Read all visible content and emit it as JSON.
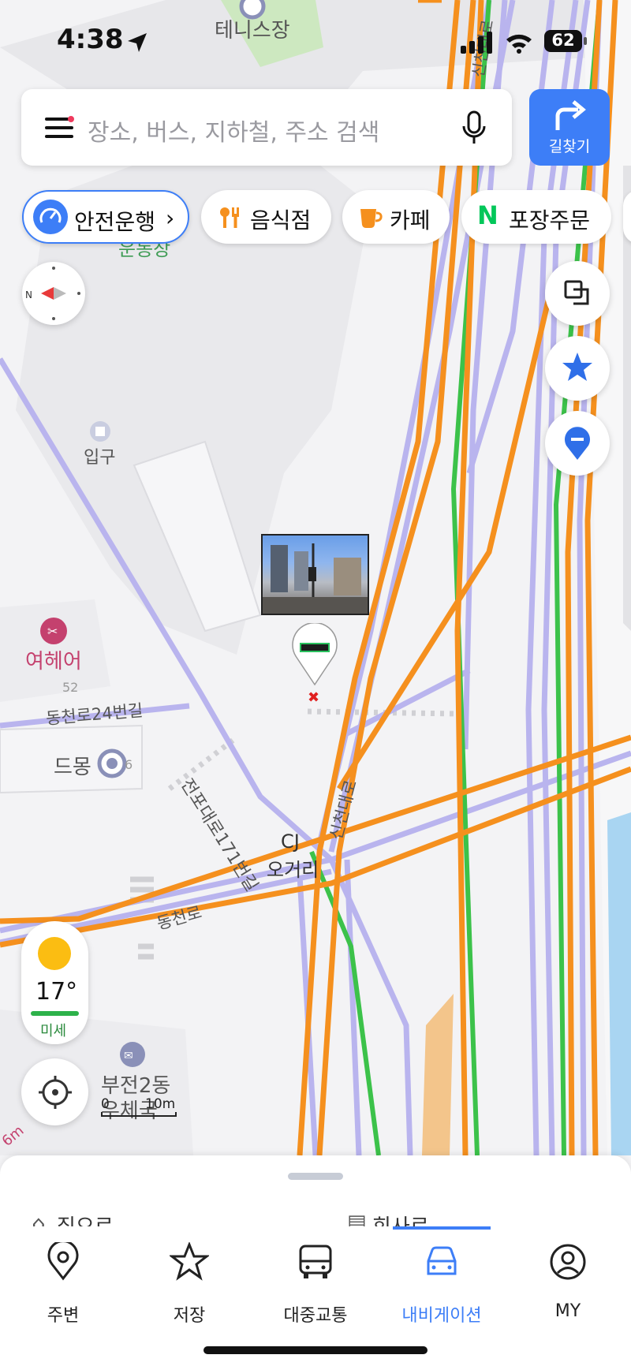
{
  "status": {
    "time": "4:38",
    "battery": "62"
  },
  "search": {
    "placeholder": "장소, 버스, 지하철, 주소 검색"
  },
  "route_button": {
    "label": "길찾기"
  },
  "chips": [
    {
      "label": "안전운행",
      "icon": "speedometer-icon"
    },
    {
      "label": "음식점",
      "icon": "utensils-icon"
    },
    {
      "label": "카페",
      "icon": "coffee-cup-icon"
    },
    {
      "label": "포장주문",
      "icon": "naver-n-icon"
    }
  ],
  "map": {
    "labels": {
      "tennis": "테니스장",
      "sports": "운동장",
      "entrance": "입구",
      "salon": "여헤어",
      "building_no": "52",
      "road_24": "동천로24번길",
      "dromong": "드몽",
      "dromong_no": "6",
      "jeonpo": "전포대로171번길",
      "sinchon": "신천대로",
      "sinchon_top": "신천대로",
      "cj": "CJ",
      "ogeori": "오거리",
      "dongcheon": "동천로",
      "post_office_1": "부전2동",
      "post_office_2": "우체국",
      "scale": "10m",
      "scale_zero": "0",
      "distance": "6m"
    }
  },
  "weather": {
    "temp": "17°",
    "dust": "미세"
  },
  "sheet": {
    "home": "집으로",
    "work": "회사로"
  },
  "tabs": [
    {
      "label": "주변",
      "icon": "location-pin-icon"
    },
    {
      "label": "저장",
      "icon": "star-icon"
    },
    {
      "label": "대중교통",
      "icon": "bus-icon"
    },
    {
      "label": "내비게이션",
      "icon": "car-icon",
      "active": true
    },
    {
      "label": "MY",
      "icon": "profile-icon"
    }
  ],
  "colors": {
    "accent": "#3d7ef7",
    "road_orange": "#f5901e",
    "road_purple": "#b9b4ee",
    "road_green": "#3cc24a",
    "water": "#a9d5f2",
    "pink": "#c4416e"
  }
}
